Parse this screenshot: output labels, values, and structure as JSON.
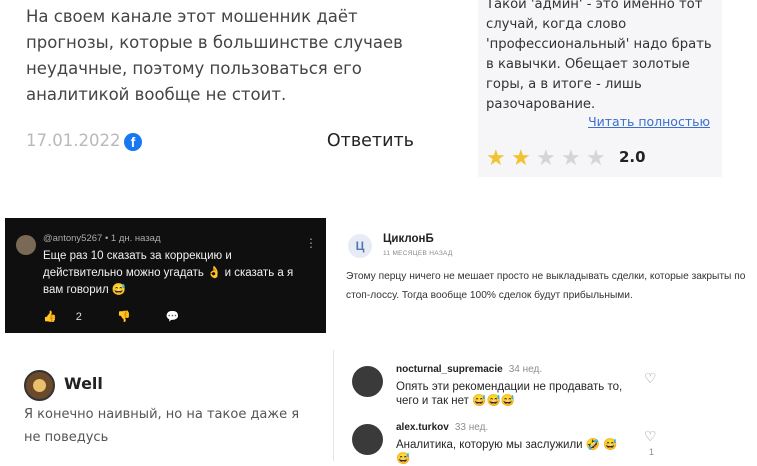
{
  "comment1": {
    "text": "На своем канале этот мошенник даёт прогнозы, которые в большинстве случаев неудачные, поэтому пользоваться его аналитикой вообще не стоит.",
    "date": "17.01.2022",
    "fb_icon": "facebook-icon",
    "reply": "Ответить"
  },
  "review": {
    "text": "Такой 'админ' - это именно тот случай, когда слово 'профессиональный' надо брать в кавычки. Обещает золотые горы, а в итоге - лишь разочарование.",
    "more": "Читать полностью",
    "stars": [
      "★",
      "★",
      "★",
      "★",
      "★"
    ],
    "rating_value": 2,
    "rating": "2.0",
    "colors": {
      "star_on": "#f2c230",
      "star_off": "#d5d5d9"
    }
  },
  "youtube": {
    "meta": "@antony5267 • 1 дн. назад",
    "text": "Еще раз 10 сказать за коррекцию и действительно можно угадать 👌 и сказать а я вам говорил 😅",
    "likes": "2",
    "like_icon": "👍",
    "dislike_icon": "👎",
    "reply_icon": "💬",
    "menu_icon": "⋮"
  },
  "tsiklon": {
    "initial": "Ц",
    "name": "ЦиклонБ",
    "ago": "11 МЕСЯЦЕВ НАЗАД",
    "text": "Этому перцу ничего не мешает просто не выкладывать сделки, которые закрыты по стоп-лоссу. Тогда вообще 100% сделок будут прибыльными."
  },
  "well": {
    "name": "Well",
    "text": "Я конечно наивный, но на такое даже я не поведусь"
  },
  "instagram": {
    "comments": [
      {
        "name": "nocturnal_supremacie",
        "time": "34 нед.",
        "text": "Опять эти рекомендации не продавать то, чего и так нет 😅😅😅",
        "likes": ""
      },
      {
        "name": "alex.turkov",
        "time": "33 нед.",
        "text": "Аналитика, которую мы заслужили 🤣 😅😅",
        "likes": "1"
      }
    ],
    "heart_icon": "♡"
  }
}
